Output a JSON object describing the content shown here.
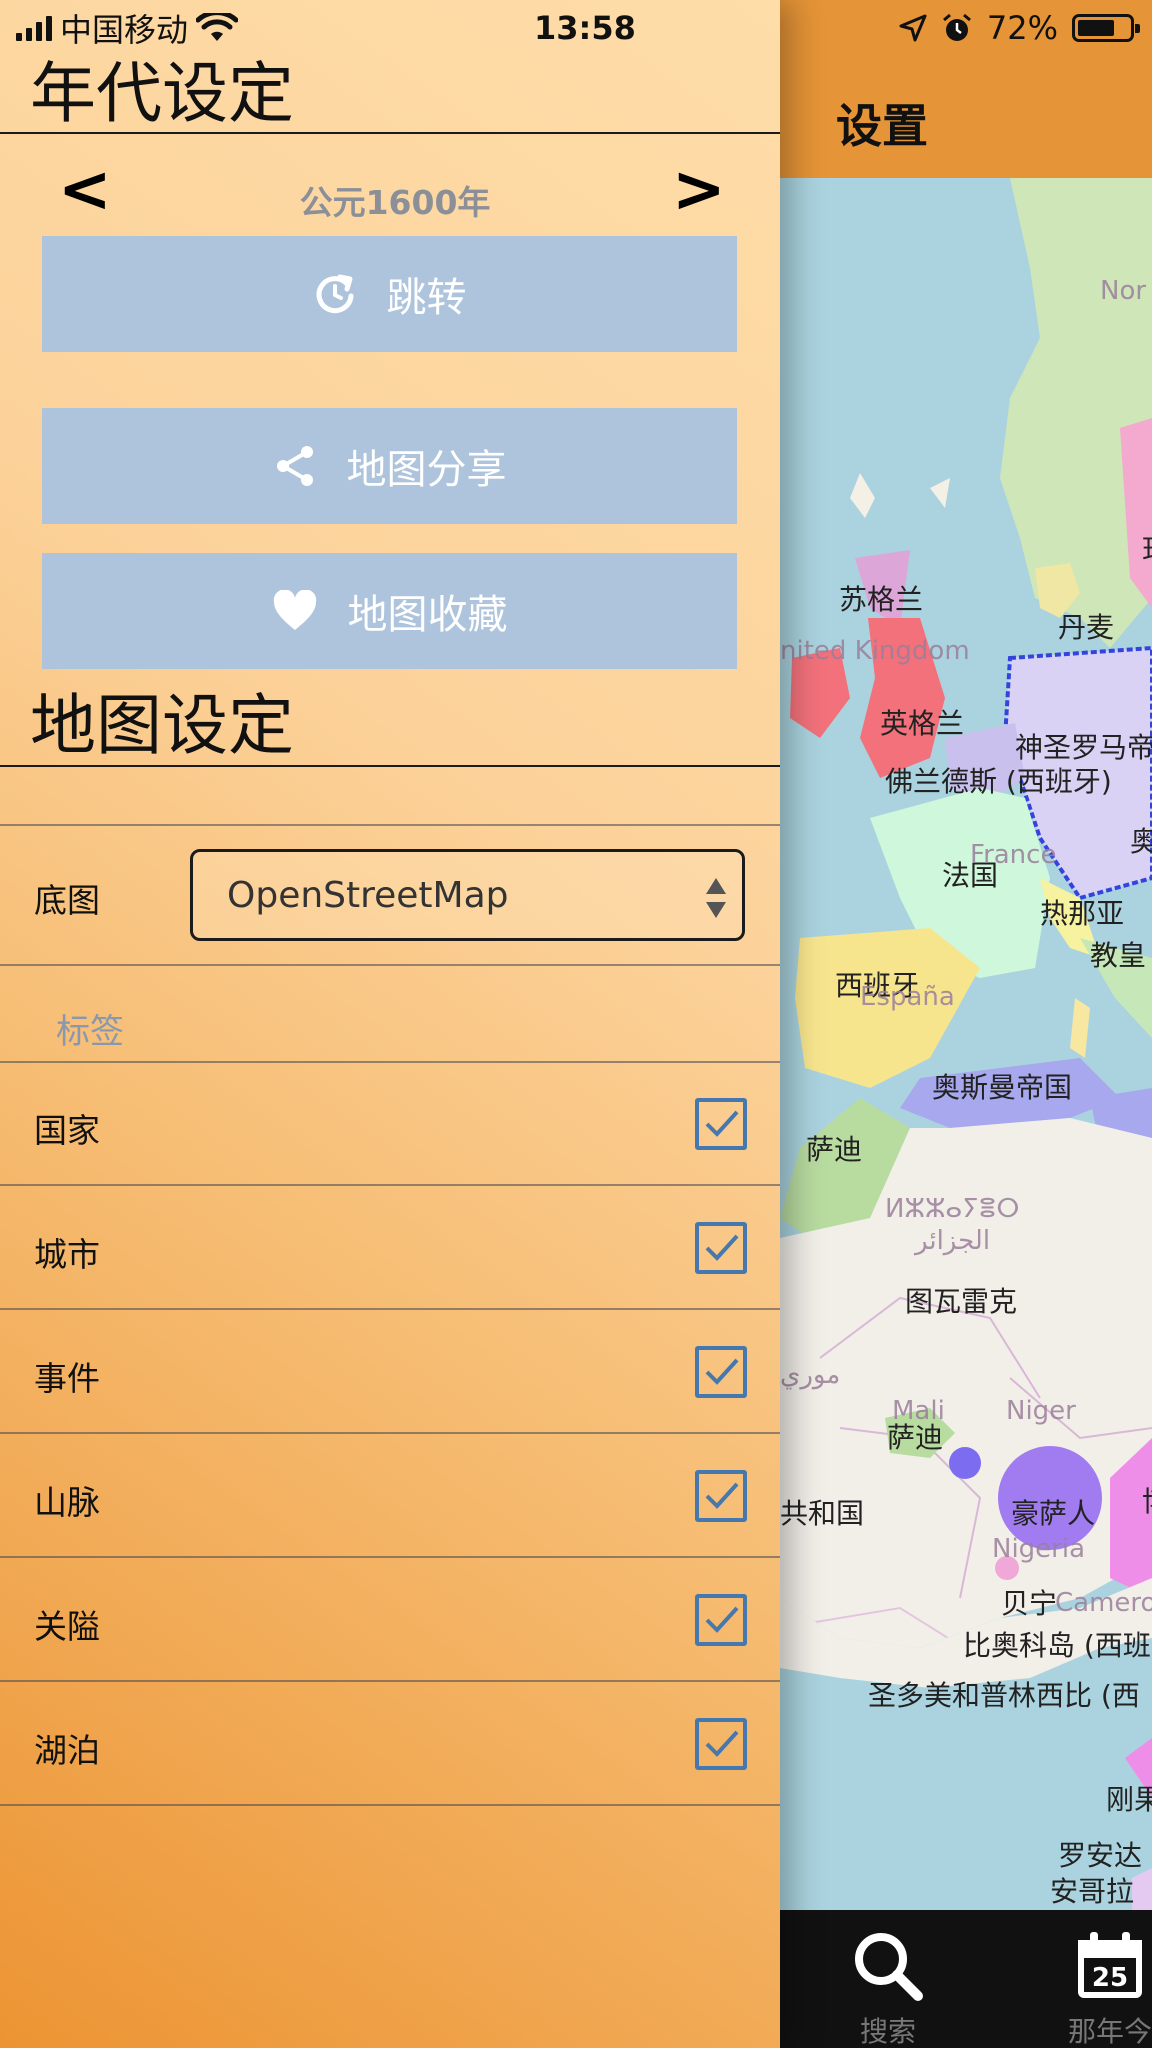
{
  "status": {
    "carrier": "中国移动",
    "time": "13:58",
    "battery_pct": "72%",
    "battery_level": 0.72
  },
  "panel": {
    "era_title": "年代设定",
    "prev_label": "<",
    "next_label": ">",
    "year": "公元1600年",
    "jump_label": "跳转",
    "share_label": "地图分享",
    "fav_label": "地图收藏",
    "map_title": "地图设定",
    "base_label": "底图",
    "base_value": "OpenStreetMap",
    "group_label": "标签",
    "options": [
      {
        "label": "国家",
        "checked": true
      },
      {
        "label": "城市",
        "checked": true
      },
      {
        "label": "事件",
        "checked": true
      },
      {
        "label": "山脉",
        "checked": true
      },
      {
        "label": "关隘",
        "checked": true
      },
      {
        "label": "湖泊",
        "checked": true
      }
    ]
  },
  "map": {
    "header_title": "设置",
    "labels": [
      "苏格兰",
      "丹麦",
      "英格兰",
      "神圣罗马帝",
      "佛兰德斯 (西班牙)",
      "法国",
      "热那亚",
      "教皇",
      "西班牙",
      "奥斯曼帝国",
      "萨迪",
      "图瓦雷克",
      "萨迪",
      "豪萨人",
      "贝宁",
      "比奥科岛 (西班",
      "圣多美和普林西比 (西",
      "刚果",
      "罗安达",
      "安哥拉",
      "奥",
      "珏",
      "博",
      "共和国"
    ],
    "faint": [
      "Nor",
      "nited Kingdom",
      "France",
      "España",
      "ⵍⵣⵣⴰⵢⴻⵔ",
      "الجزائر",
      "Mali",
      "Niger",
      "Nigeria",
      "Camero",
      "موري"
    ]
  },
  "tabs": [
    {
      "label": "搜索",
      "icon": "search-icon"
    },
    {
      "label": "那年今",
      "icon": "calendar-icon",
      "day": "25"
    }
  ],
  "colors": {
    "panel_accent": "#f0a246",
    "button_bg": "#aec4dc",
    "checkbox": "#4478ae",
    "map_header": "#e59437"
  }
}
